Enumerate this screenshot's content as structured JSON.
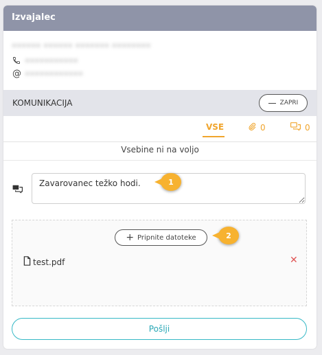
{
  "header": {
    "title": "Izvajalec"
  },
  "contact": {
    "name_blurred": "•••••• •••••• ••••••• ••••••••",
    "phone_blurred": "•••••••••••",
    "email_blurred": "••••••••••••"
  },
  "communication": {
    "label": "KOMUNIKACIJA",
    "close_label": "ZAPRI",
    "tabs": {
      "all": "VSE",
      "attachments_count": "0",
      "messages_count": "0"
    },
    "empty_text": "Vsebine ni na voljo"
  },
  "compose": {
    "message_value": "Zavarovanec težko hodi.",
    "attach_label": "Pripnite datoteke",
    "file_name": "test.pdf",
    "send_label": "Pošlji"
  },
  "callouts": {
    "first": "1",
    "second": "2"
  },
  "colors": {
    "header_bg": "#8f94a8",
    "accent": "#f0a52d",
    "send": "#35b8c6",
    "remove": "#e05555",
    "callout": "#f7b230"
  },
  "icons": [
    "phone-icon",
    "at-icon",
    "minus-icon",
    "paperclip-icon",
    "chat-icon",
    "message-icon",
    "plus-icon",
    "file-icon",
    "close-x-icon"
  ]
}
